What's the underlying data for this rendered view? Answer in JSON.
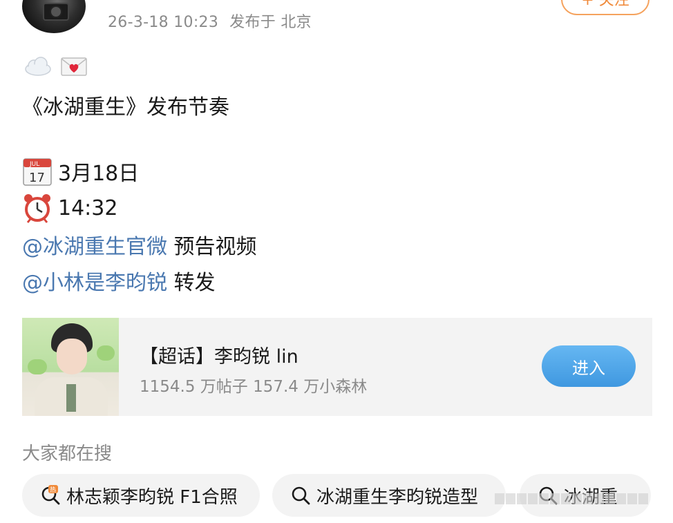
{
  "post": {
    "timestamp": "26-3-18 10:23",
    "location": "发布于 北京",
    "follow_label": "+ 关注",
    "emoji_icons": [
      "cloud-icon",
      "love-letter-icon"
    ],
    "title_line": "《冰湖重生》发布节奏",
    "date_text": "3月18日",
    "calendar_icon_text": "JUL",
    "calendar_day": "17",
    "time_text": "14:32",
    "mentions": [
      {
        "handle": "@冰湖重生官微",
        "suffix": " 预告视频"
      },
      {
        "handle": "@小林是李昀锐",
        "suffix": " 转发"
      }
    ]
  },
  "card": {
    "title": "【超话】李昀锐 lin",
    "stats": "1154.5 万帖子 157.4 万小森林",
    "enter_label": "进入"
  },
  "search": {
    "heading": "大家都在搜",
    "chips": [
      {
        "label": "林志颖李昀锐 F1合照",
        "icon": "hot-search-icon"
      },
      {
        "label": "冰湖重生李昀锐造型",
        "icon": "search-icon"
      },
      {
        "label": "冰湖重",
        "icon": "search-icon"
      }
    ]
  },
  "colors": {
    "mention": "#4a78b0",
    "follow": "#f08a3a",
    "enter_button": "#4aa3e8",
    "muted": "#8a8a8a"
  }
}
